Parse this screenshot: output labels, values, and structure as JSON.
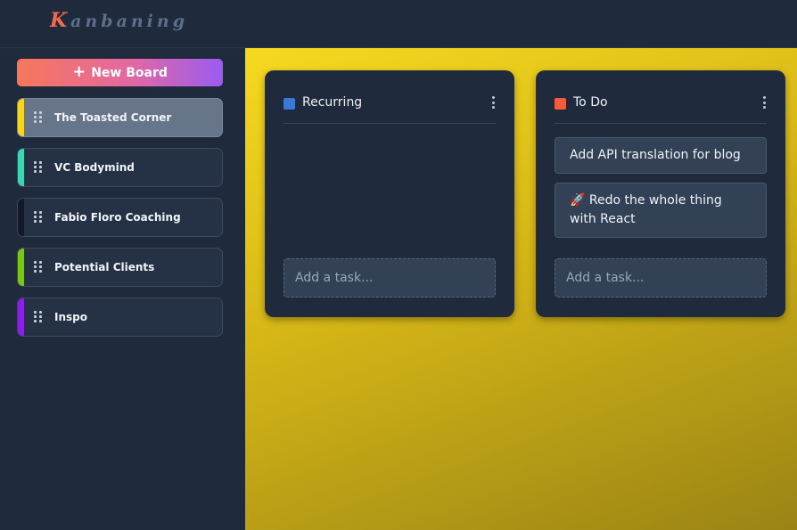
{
  "app": {
    "logo_first": "K",
    "logo_rest": "anbaning"
  },
  "sidebar": {
    "new_board_label": "New Board",
    "new_board_icon": "plus-icon",
    "boards": [
      {
        "label": "The Toasted Corner",
        "color": "#f5d422",
        "active": true
      },
      {
        "label": "VC Bodymind",
        "color": "#3ed4b0",
        "active": false
      },
      {
        "label": "Fabio Floro Coaching",
        "color": "#111a26",
        "active": false
      },
      {
        "label": "Potential Clients",
        "color": "#7ac41c",
        "active": false
      },
      {
        "label": "Inspo",
        "color": "#8a1fe8",
        "active": false
      }
    ]
  },
  "main": {
    "background_colors": [
      "#f6d91f",
      "#9a8415"
    ],
    "columns": [
      {
        "title": "Recurring",
        "color": "#3a79d6",
        "tasks": [],
        "add_placeholder": "Add a task..."
      },
      {
        "title": "To Do",
        "color": "#f25c3a",
        "tasks": [
          {
            "text": "Add API translation for blog"
          },
          {
            "text": "🚀 Redo the whole thing with React"
          }
        ],
        "add_placeholder": "Add a task..."
      }
    ]
  }
}
